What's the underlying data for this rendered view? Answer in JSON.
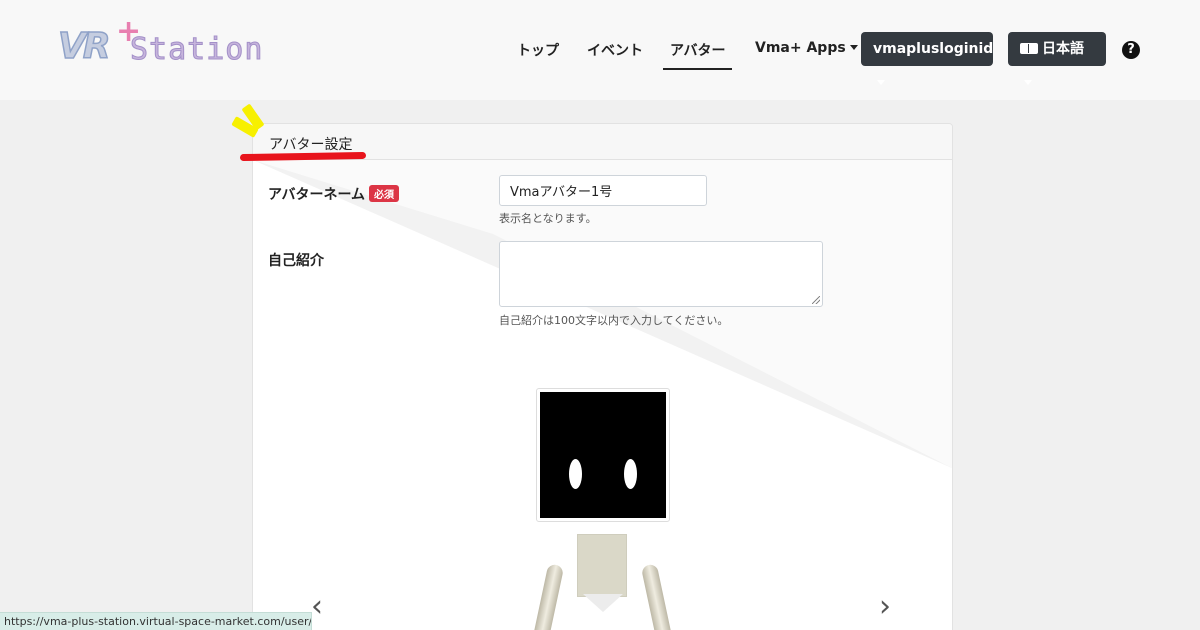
{
  "header": {
    "logo_text": "VR+Station",
    "logo_vr": "VR",
    "logo_plus": "+",
    "logo_station": "Station",
    "nav": [
      {
        "label": "トップ"
      },
      {
        "label": "イベント"
      },
      {
        "label": "アバター",
        "active": true
      },
      {
        "label": "Vma+ Apps"
      }
    ],
    "user_button": "vmaplusloginid",
    "language_button": "日本語",
    "help_icon": "question-circle-icon",
    "lang_icon": "language-icon"
  },
  "card": {
    "title": "アバター設定",
    "avatar_name": {
      "label": "アバターネーム",
      "required_badge": "必須",
      "value": "Vmaアバター1号",
      "help": "表示名となります。"
    },
    "bio": {
      "label": "自己紹介",
      "value": "",
      "help": "自己紹介は100文字以内で入力してください。"
    },
    "prev_arrow": "‹",
    "next_arrow": "›"
  },
  "colors": {
    "accent_dark": "#343a40",
    "required_red": "#dc3545",
    "highlight_red": "#e8141c",
    "highlight_yellow": "#f7f000"
  },
  "status_bar": {
    "url": "https://vma-plus-station.virtual-space-market.com/user/top"
  }
}
